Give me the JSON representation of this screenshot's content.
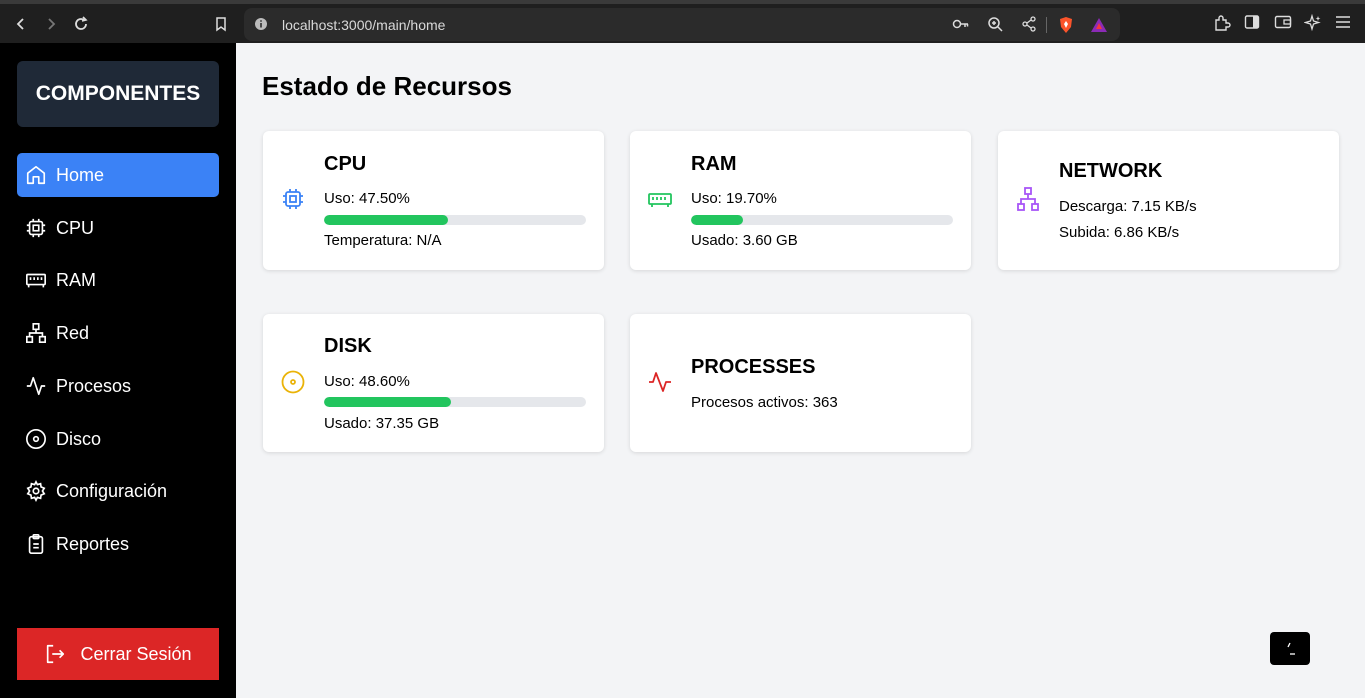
{
  "browser": {
    "url": "localhost:3000/main/home"
  },
  "sidebar": {
    "brand": "COMPONENTES",
    "items": [
      {
        "label": "Home",
        "icon": "home-icon",
        "active": true
      },
      {
        "label": "CPU",
        "icon": "cpu-icon"
      },
      {
        "label": "RAM",
        "icon": "memory-icon"
      },
      {
        "label": "Red",
        "icon": "network-icon"
      },
      {
        "label": "Procesos",
        "icon": "activity-icon"
      },
      {
        "label": "Disco",
        "icon": "disc-icon"
      },
      {
        "label": "Configuración",
        "icon": "gear-icon"
      },
      {
        "label": "Reportes",
        "icon": "clipboard-icon"
      }
    ],
    "logout": "Cerrar Sesión"
  },
  "main": {
    "title": "Estado de Recursos",
    "cards": {
      "cpu": {
        "title": "CPU",
        "usage": "Uso: 47.50%",
        "usage_pct": 47.5,
        "extra": "Temperatura: N/A"
      },
      "ram": {
        "title": "RAM",
        "usage": "Uso: 19.70%",
        "usage_pct": 19.7,
        "extra": "Usado: 3.60 GB"
      },
      "network": {
        "title": "NETWORK",
        "download": "Descarga: 7.15 KB/s",
        "upload": "Subida: 6.86 KB/s"
      },
      "disk": {
        "title": "DISK",
        "usage": "Uso: 48.60%",
        "usage_pct": 48.6,
        "extra": "Usado: 37.35 GB"
      },
      "processes": {
        "title": "PROCESSES",
        "active": "Procesos activos: 363"
      }
    }
  },
  "colors": {
    "active": "#3b82f6",
    "logout": "#dc2626",
    "bar_fill": "#22c55e",
    "cpu_icon": "#3b82f6",
    "ram_icon": "#22c55e",
    "network_icon": "#a855f7",
    "disk_icon": "#eab308",
    "processes_icon": "#dc2626"
  }
}
